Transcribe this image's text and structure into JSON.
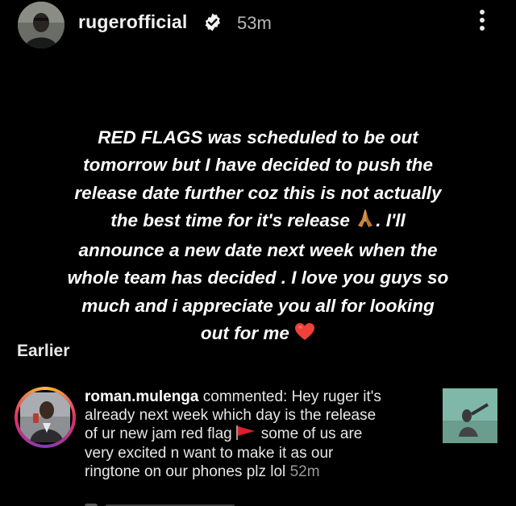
{
  "header": {
    "username": "rugerofficial",
    "time_ago": "53m"
  },
  "story": {
    "lines": [
      "RED FLAGS was scheduled to be out",
      "tomorrow but I have decided to push the",
      "release date further coz this is not actually",
      "the best time for it's release",
      ". I'll",
      "announce a new date next week when the",
      "whole team has decided . I love you guys so",
      "much and i appreciate you all for looking",
      "out for me"
    ]
  },
  "section": {
    "earlier_label": "Earlier"
  },
  "notification": {
    "username": "roman.mulenga",
    "text_line1": " commented: Hey ruger it's",
    "text_line2": "already next week which day is the release",
    "text_line3_a": "of ur new jam red flag",
    "text_line3_b": "some of us are",
    "text_line4": "very excited n want to make it as our",
    "text_line5": "ringtone on our phones plz lol",
    "time_ago": "52m"
  },
  "colors": {
    "background": "#000000",
    "verified_badge": "#ffffff",
    "flag_red": "#d9202b",
    "heart_red": "#f0403a"
  }
}
